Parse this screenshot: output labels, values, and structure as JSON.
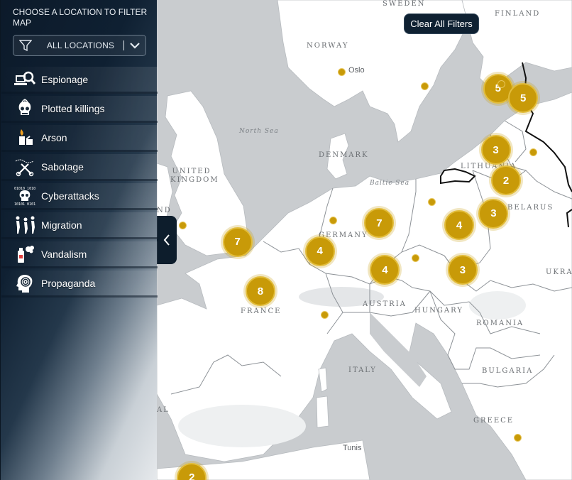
{
  "sidebar": {
    "filter_title": "CHOOSE A LOCATION TO FILTER MAP",
    "location_select": {
      "selected": "ALL LOCATIONS",
      "filter_icon": "filter-icon",
      "chevron_icon": "chevron-down-icon"
    },
    "categories": [
      {
        "label": "Espionage",
        "icon": "espionage-icon"
      },
      {
        "label": "Plotted killings",
        "icon": "skull-crosshair-icon"
      },
      {
        "label": "Arson",
        "icon": "arson-icon"
      },
      {
        "label": "Sabotage",
        "icon": "sabotage-icon"
      },
      {
        "label": "Cyberattacks",
        "icon": "cyber-skull-icon"
      },
      {
        "label": "Migration",
        "icon": "migration-icon"
      },
      {
        "label": "Vandalism",
        "icon": "spray-can-icon"
      },
      {
        "label": "Propaganda",
        "icon": "propaganda-head-icon"
      }
    ]
  },
  "map": {
    "clear_button": "Clear All Filters",
    "zoom_in": "+",
    "zoom_out": "−",
    "countries": [
      "SWEDEN",
      "FINLAND",
      "NORWAY",
      "DENMARK",
      "UNITED KINGDOM",
      "LITHUANIA",
      "BELARUS",
      "GERMANY",
      "FRANCE",
      "AUSTRIA",
      "HUNGARY",
      "ROMANIA",
      "BULGARIA",
      "ITALY",
      "GREECE",
      "UKRA",
      "ND",
      "AL"
    ],
    "seas": [
      "North Sea",
      "Baltic Sea"
    ],
    "cities": [
      "Oslo",
      "Tunis"
    ],
    "clusters": [
      {
        "count": "5",
        "lon": 24.4,
        "lat": 59.2
      },
      {
        "count": "5",
        "lon": 26.6,
        "lat": 58.8
      },
      {
        "count": "3",
        "lon": 24.2,
        "lat": 56.6
      },
      {
        "count": "2",
        "lon": 25.1,
        "lat": 55.3
      },
      {
        "count": "3",
        "lon": 24.0,
        "lat": 53.9
      },
      {
        "count": "4",
        "lon": 21.0,
        "lat": 53.4
      },
      {
        "count": "7",
        "lon": 14.0,
        "lat": 53.5
      },
      {
        "count": "7",
        "lon": 1.6,
        "lat": 52.7
      },
      {
        "count": "4",
        "lon": 8.8,
        "lat": 52.3
      },
      {
        "count": "4",
        "lon": 14.5,
        "lat": 51.5
      },
      {
        "count": "3",
        "lon": 21.3,
        "lat": 51.5
      },
      {
        "count": "8",
        "lon": 3.6,
        "lat": 50.6
      },
      {
        "count": "2",
        "lon": -2.4,
        "lat": 42.7
      }
    ],
    "points": [
      {
        "lon": 10.7,
        "lat": 59.9
      },
      {
        "lon": 18.0,
        "lat": 59.3
      },
      {
        "lon": 24.7,
        "lat": 59.4
      },
      {
        "lon": 27.5,
        "lat": 56.5
      },
      {
        "lon": 18.6,
        "lat": 54.4
      },
      {
        "lon": 10.0,
        "lat": 53.6
      },
      {
        "lon": -3.2,
        "lat": 53.4
      },
      {
        "lon": 17.2,
        "lat": 52.0
      },
      {
        "lon": 9.2,
        "lat": 49.6
      },
      {
        "lon": 26.1,
        "lat": 44.4
      }
    ]
  }
}
